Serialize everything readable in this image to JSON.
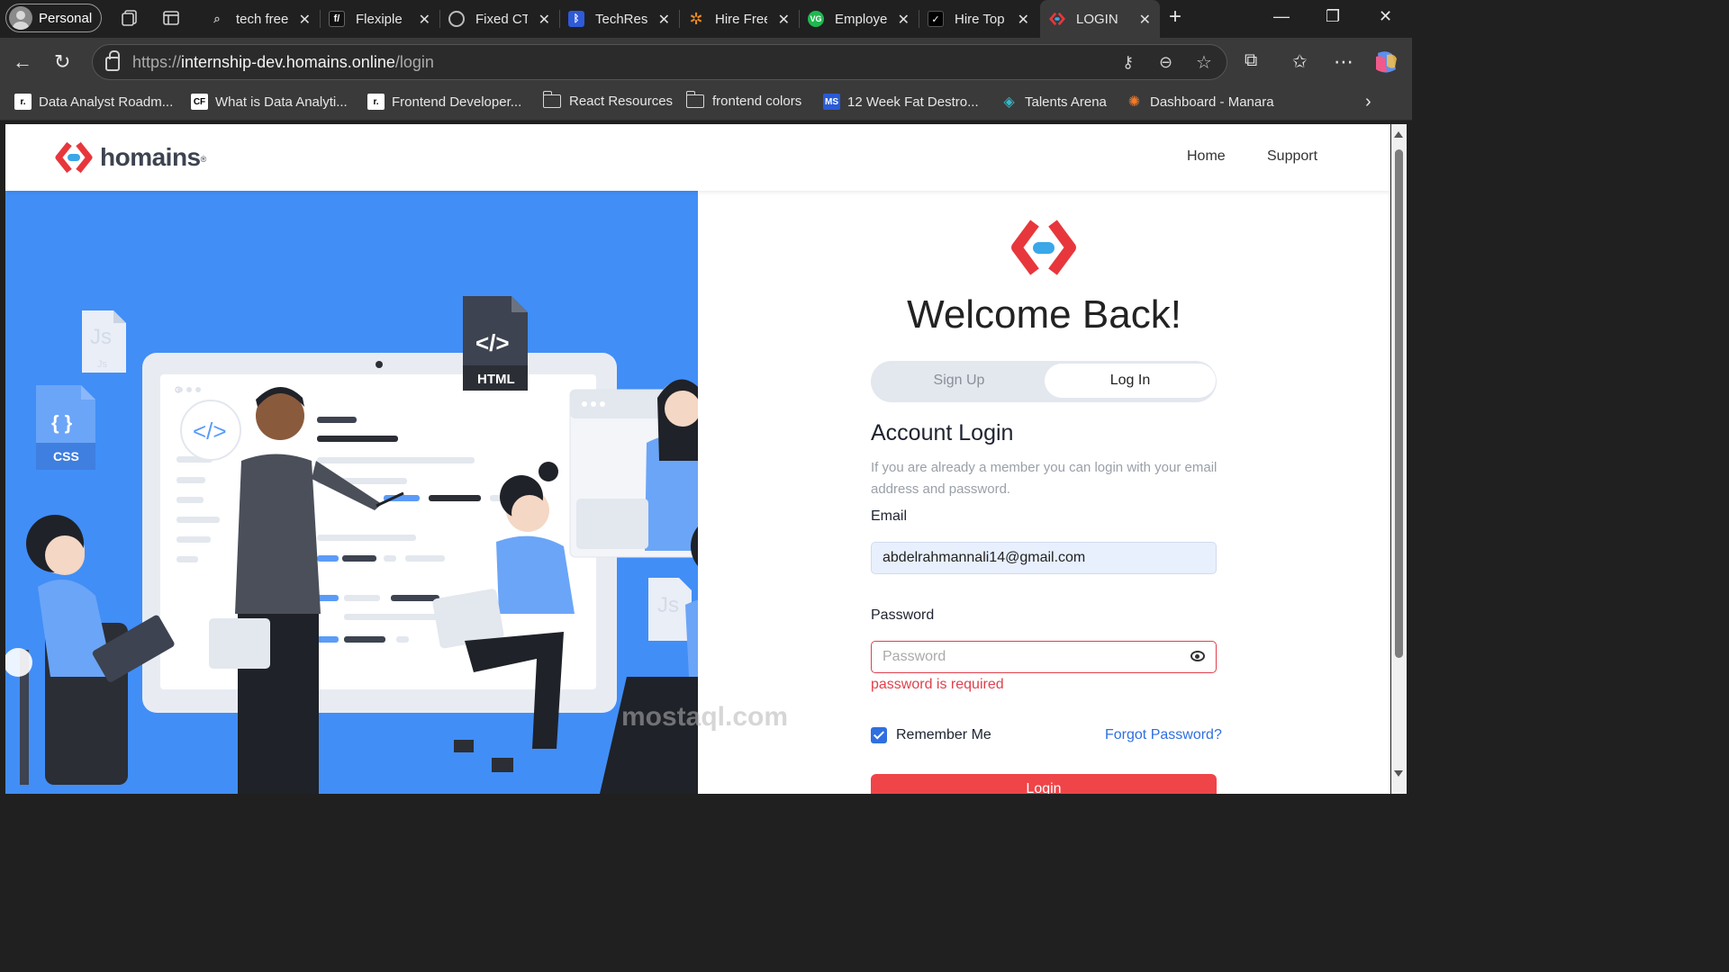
{
  "browser": {
    "profile": "Personal",
    "tabs": [
      {
        "title": "tech free",
        "favicon": "search-icon"
      },
      {
        "title": "Flexiple",
        "favicon": "flexiple-icon"
      },
      {
        "title": "Fixed CT",
        "favicon": "openai-icon"
      },
      {
        "title": "TechRes",
        "favicon": "techres-icon"
      },
      {
        "title": "Hire Free",
        "favicon": "hire-icon"
      },
      {
        "title": "Employe",
        "favicon": "vg-icon"
      },
      {
        "title": "Hire Top",
        "favicon": "toptal-icon"
      },
      {
        "title": "LOGIN",
        "favicon": "homains-icon"
      }
    ],
    "url_prefix": "https://",
    "url_domain": "internship-dev.homains.online",
    "url_path": "/login",
    "bookmarks": [
      "Data Analyst Roadm...",
      "What is Data Analyti...",
      "Frontend Developer...",
      "React Resources",
      "frontend colors",
      "12 Week Fat Destro...",
      "Talents Arena",
      "Dashboard - Manara"
    ]
  },
  "site": {
    "brand": "homains",
    "brand_mark": "®",
    "nav": {
      "home": "Home",
      "support": "Support"
    }
  },
  "illustration": {
    "html_label": "HTML",
    "css_label": "CSS",
    "css_glyph": "{ }",
    "js_label": "Js",
    "code_glyph": "</>"
  },
  "login": {
    "title": "Welcome Back!",
    "toggle_signup": "Sign Up",
    "toggle_login": "Log In",
    "account_title": "Account Login",
    "description": "If you are already a member you can login with your email address and password.",
    "email_label": "Email",
    "email_value": "abdelrahmannali14@gmail.com",
    "password_label": "Password",
    "password_placeholder": "Password",
    "password_error": "password is required",
    "remember_label": "Remember Me",
    "forgot_label": "Forgot Password?",
    "login_button": "Login"
  },
  "colors": {
    "accent_red": "#ef4448",
    "hero_blue": "#418ef7",
    "link_blue": "#2f6fe0"
  },
  "watermark": "mostaql.com"
}
